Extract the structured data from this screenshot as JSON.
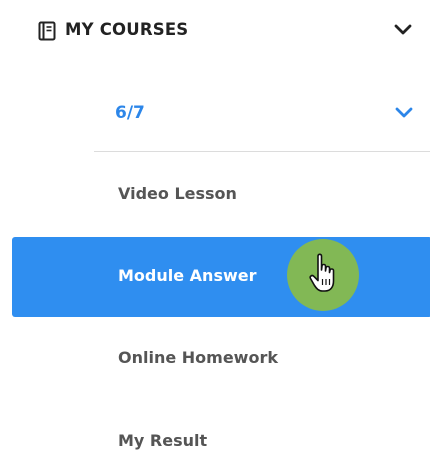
{
  "header": {
    "title": "MY COURSES",
    "icon": "book-icon",
    "toggle_icon": "chevron-down-icon"
  },
  "course": {
    "label": "6/7",
    "toggle_icon": "chevron-down-icon"
  },
  "menu": {
    "items": [
      {
        "label": "Video Lesson",
        "active": false
      },
      {
        "label": "Module Answer",
        "active": true
      },
      {
        "label": "Online Homework",
        "active": false
      },
      {
        "label": "My Result",
        "active": false
      }
    ]
  },
  "cursor": {
    "icon": "hand-pointer-icon"
  },
  "colors": {
    "accent": "#2f8ef0",
    "accent_text": "#2c86e9",
    "cursor_highlight": "#8abc48",
    "text": "#555555",
    "heading": "#222222"
  }
}
